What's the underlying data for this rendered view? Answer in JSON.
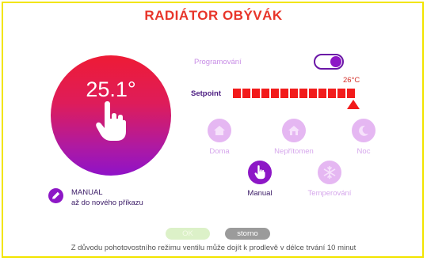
{
  "title": "RADIÁTOR OBÝVÁK",
  "dial": {
    "temperature": "25.1°"
  },
  "manual_status": {
    "line1": "MANUAL",
    "line2": "až do nového příkazu"
  },
  "programovani": {
    "label": "Programování",
    "enabled": true
  },
  "setpoint": {
    "label": "Setpoint",
    "value": "26°C",
    "segments": 13
  },
  "modes": [
    {
      "label": "Doma",
      "icon": "home-icon",
      "active": false
    },
    {
      "label": "Nepřítomen",
      "icon": "home-away-icon",
      "active": false
    },
    {
      "label": "Noc",
      "icon": "moon-icon",
      "active": false
    },
    {
      "label": "Manual",
      "icon": "hand-icon",
      "active": true
    },
    {
      "label": "Temperování",
      "icon": "snowflake-icon",
      "active": false
    }
  ],
  "buttons": {
    "ok": "OK",
    "storno": "storno"
  },
  "notice": "Z důvodu pohotovostního režimu ventilu může dojít k prodlevě v délce trvání 10 minut",
  "colors": {
    "title": "#e8352a",
    "accent": "#8d17c6",
    "setpoint": "#f21b1b",
    "border": "#f2e500"
  }
}
